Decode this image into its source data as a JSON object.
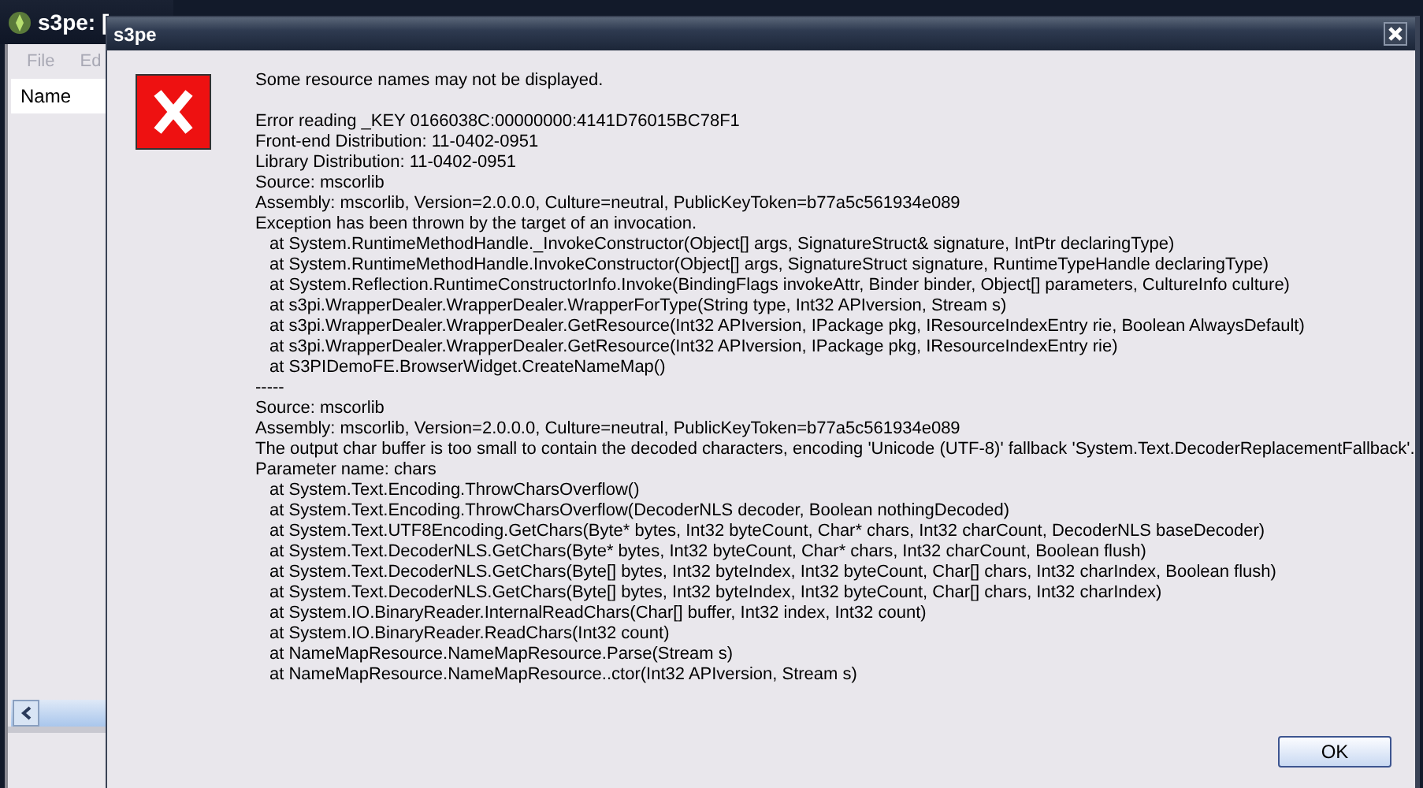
{
  "main_window": {
    "title": "s3pe: [",
    "menu": [
      "File",
      "Ed"
    ],
    "columns": [
      "Name"
    ]
  },
  "dialog": {
    "title": "s3pe",
    "summary": "Some resource names may not be displayed.",
    "details": [
      {
        "kind": "line",
        "text": "Error reading _KEY 0166038C:00000000:4141D76015BC78F1"
      },
      {
        "kind": "line",
        "text": "Front-end Distribution: 11-0402-0951"
      },
      {
        "kind": "line",
        "text": "Library Distribution: 11-0402-0951"
      },
      {
        "kind": "line",
        "text": "Source: mscorlib"
      },
      {
        "kind": "line",
        "text": "Assembly: mscorlib, Version=2.0.0.0, Culture=neutral, PublicKeyToken=b77a5c561934e089"
      },
      {
        "kind": "line",
        "text": "Exception has been thrown by the target of an invocation."
      },
      {
        "kind": "frame",
        "text": "at System.RuntimeMethodHandle._InvokeConstructor(Object[] args, SignatureStruct& signature, IntPtr declaringType)"
      },
      {
        "kind": "frame",
        "text": "at System.RuntimeMethodHandle.InvokeConstructor(Object[] args, SignatureStruct signature, RuntimeTypeHandle declaringType)"
      },
      {
        "kind": "frame",
        "text": "at System.Reflection.RuntimeConstructorInfo.Invoke(BindingFlags invokeAttr, Binder binder, Object[] parameters, CultureInfo culture)"
      },
      {
        "kind": "frame",
        "text": "at s3pi.WrapperDealer.WrapperDealer.WrapperForType(String type, Int32 APIversion, Stream s)"
      },
      {
        "kind": "frame",
        "text": "at s3pi.WrapperDealer.WrapperDealer.GetResource(Int32 APIversion, IPackage pkg, IResourceIndexEntry rie, Boolean AlwaysDefault)"
      },
      {
        "kind": "frame",
        "text": "at s3pi.WrapperDealer.WrapperDealer.GetResource(Int32 APIversion, IPackage pkg, IResourceIndexEntry rie)"
      },
      {
        "kind": "frame",
        "text": "at S3PIDemoFE.BrowserWidget.CreateNameMap()"
      },
      {
        "kind": "line",
        "text": "-----"
      },
      {
        "kind": "line",
        "text": "Source: mscorlib"
      },
      {
        "kind": "line",
        "text": "Assembly: mscorlib, Version=2.0.0.0, Culture=neutral, PublicKeyToken=b77a5c561934e089"
      },
      {
        "kind": "line",
        "text": "The output char buffer is too small to contain the decoded characters, encoding 'Unicode (UTF-8)' fallback 'System.Text.DecoderReplacementFallback'."
      },
      {
        "kind": "line",
        "text": "Parameter name: chars"
      },
      {
        "kind": "frame",
        "text": "at System.Text.Encoding.ThrowCharsOverflow()"
      },
      {
        "kind": "frame",
        "text": "at System.Text.Encoding.ThrowCharsOverflow(DecoderNLS decoder, Boolean nothingDecoded)"
      },
      {
        "kind": "frame",
        "text": "at System.Text.UTF8Encoding.GetChars(Byte* bytes, Int32 byteCount, Char* chars, Int32 charCount, DecoderNLS baseDecoder)"
      },
      {
        "kind": "frame",
        "text": "at System.Text.DecoderNLS.GetChars(Byte* bytes, Int32 byteCount, Char* chars, Int32 charCount, Boolean flush)"
      },
      {
        "kind": "frame",
        "text": "at System.Text.DecoderNLS.GetChars(Byte[] bytes, Int32 byteIndex, Int32 byteCount, Char[] chars, Int32 charIndex, Boolean flush)"
      },
      {
        "kind": "frame",
        "text": "at System.Text.DecoderNLS.GetChars(Byte[] bytes, Int32 byteIndex, Int32 byteCount, Char[] chars, Int32 charIndex)"
      },
      {
        "kind": "frame",
        "text": "at System.IO.BinaryReader.InternalReadChars(Char[] buffer, Int32 index, Int32 count)"
      },
      {
        "kind": "frame",
        "text": "at System.IO.BinaryReader.ReadChars(Int32 count)"
      },
      {
        "kind": "frame",
        "text": "at NameMapResource.NameMapResource.Parse(Stream s)"
      },
      {
        "kind": "frame",
        "text": "at NameMapResource.NameMapResource..ctor(Int32 APIversion, Stream s)"
      }
    ],
    "buttons": [
      "OK"
    ]
  }
}
